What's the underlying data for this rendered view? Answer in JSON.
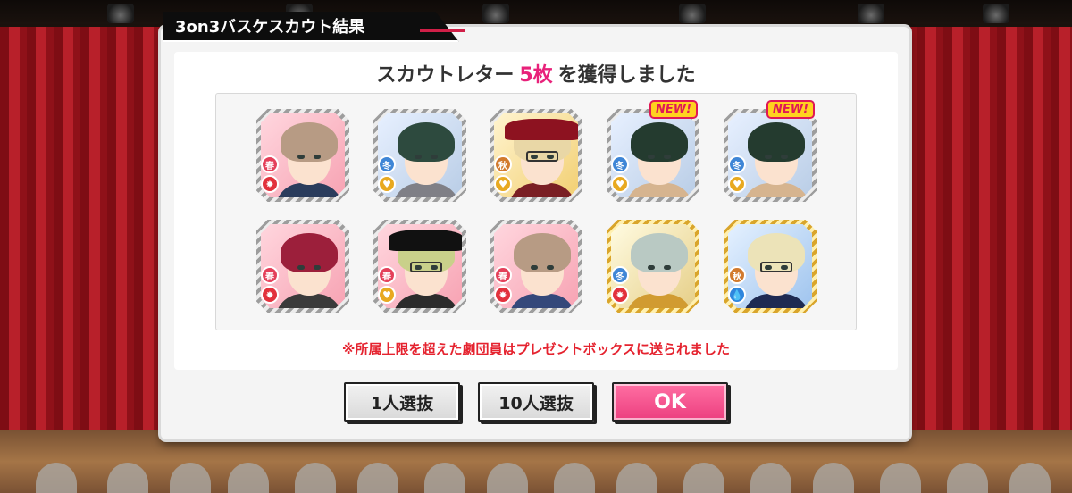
{
  "dialog": {
    "title": "3on3バスケスカウト結果",
    "heading_prefix": "スカウトレター",
    "heading_count": "5枚",
    "heading_suffix": "を獲得しました",
    "notice": "※所属上限を超えた劇団員はプレゼントボックスに送られました"
  },
  "cards": [
    {
      "season": "春",
      "attr": "✸",
      "theme": "spring",
      "new": false
    },
    {
      "season": "冬",
      "attr": "♥",
      "theme": "winter",
      "new": false
    },
    {
      "season": "秋",
      "attr": "♥",
      "theme": "autumn",
      "new": false
    },
    {
      "season": "冬",
      "attr": "♥",
      "theme": "winter",
      "new": true
    },
    {
      "season": "冬",
      "attr": "♥",
      "theme": "winter",
      "new": true
    },
    {
      "season": "春",
      "attr": "✸",
      "theme": "spring",
      "new": false
    },
    {
      "season": "春",
      "attr": "♥",
      "theme": "spring",
      "new": false
    },
    {
      "season": "春",
      "attr": "✸",
      "theme": "spring",
      "new": false
    },
    {
      "season": "冬",
      "attr": "✸",
      "theme": "gold",
      "new": false
    },
    {
      "season": "秋",
      "attr": "💧",
      "theme": "blue",
      "new": false
    }
  ],
  "new_label": "NEW!",
  "buttons": {
    "single": "1人選抜",
    "ten": "10人選抜",
    "ok": "OK"
  },
  "colors": {
    "accent_pink": "#e8217a",
    "notice_red": "#e5232f",
    "ok_button": "#ec3f7f",
    "title_bar": "#0d0d0d"
  }
}
